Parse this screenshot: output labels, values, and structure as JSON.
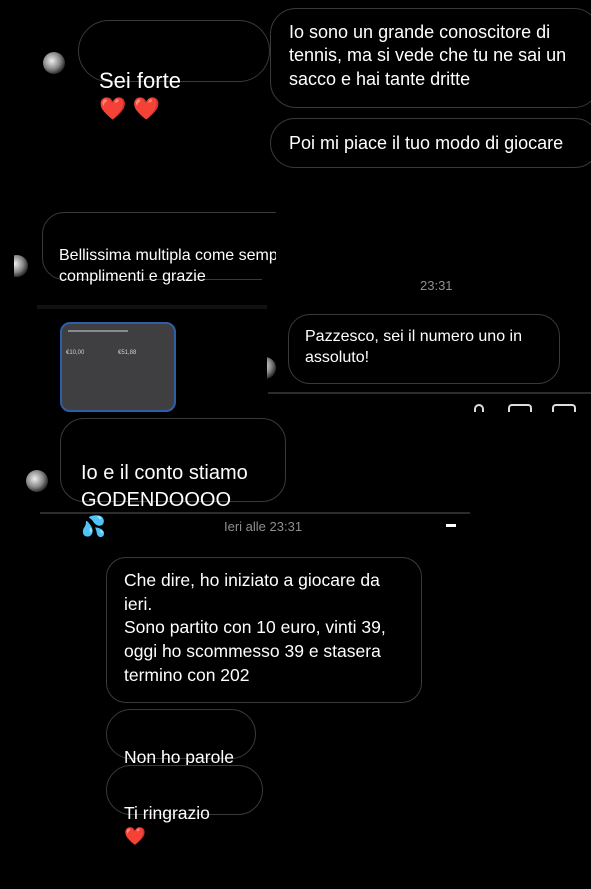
{
  "thread1": {
    "reply": {
      "text": "Sei forte",
      "emoji": "❤️ ❤️"
    },
    "messages": [
      "Io sono un grande conoscitore di\ntennis, ma si vede che tu ne sai un\nsacco e hai tante dritte",
      "Poi mi piace il tuo modo di giocare"
    ]
  },
  "thread2": {
    "message": {
      "text": "Bellissima multipla come sempre\ncomplimenti e grazie",
      "emoji": "🙏"
    }
  },
  "thread3": {
    "timestamp": "23:31",
    "message": "Pazzesco, sei il numero uno in\nassoluto!"
  },
  "thread4": {
    "screenshot": {
      "label_left": "€10,00",
      "label_right": "€51,88"
    },
    "message": {
      "text": "Io e il conto stiamo\nGODENDOOOO",
      "emoji": "💦"
    }
  },
  "thread5": {
    "timestamp": "Ieri alle 23:31",
    "message": "Che dire, ho iniziato a giocare da\nieri.\nSono partito con 10 euro, vinti 39,\noggi ho scommesso 39 e stasera\ntermino con 202",
    "replies": [
      {
        "text": "Non ho parole"
      },
      {
        "text": "Ti ringrazio",
        "emoji": "❤️"
      }
    ]
  }
}
